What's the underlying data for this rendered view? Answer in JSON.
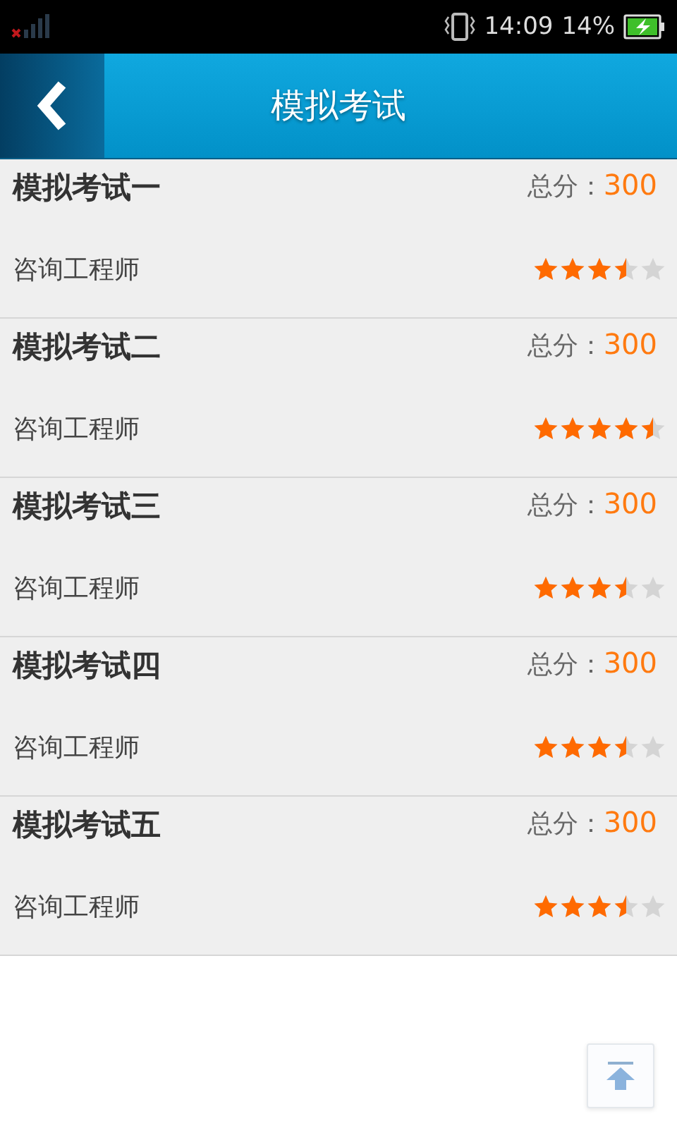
{
  "status_bar": {
    "time": "14:09",
    "battery": "14%"
  },
  "header": {
    "title": "模拟考试"
  },
  "exams": [
    {
      "title": "模拟考试一",
      "score_label": "总分：",
      "score": "300",
      "subject": "咨询工程师",
      "stars": 3.5
    },
    {
      "title": "模拟考试二",
      "score_label": "总分：",
      "score": "300",
      "subject": "咨询工程师",
      "stars": 4.5
    },
    {
      "title": "模拟考试三",
      "score_label": "总分：",
      "score": "300",
      "subject": "咨询工程师",
      "stars": 3.5
    },
    {
      "title": "模拟考试四",
      "score_label": "总分：",
      "score": "300",
      "subject": "咨询工程师",
      "stars": 3.5
    },
    {
      "title": "模拟考试五",
      "score_label": "总分：",
      "score": "300",
      "subject": "咨询工程师",
      "stars": 3.5
    }
  ]
}
